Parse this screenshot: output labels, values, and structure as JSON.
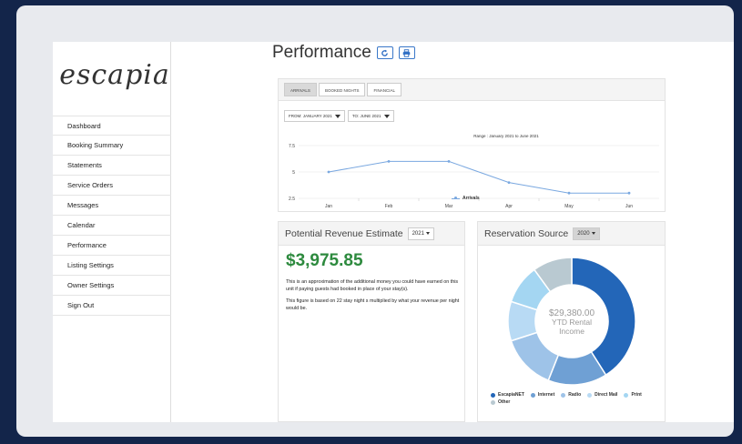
{
  "logo_text": "escapia",
  "sidebar": {
    "items": [
      {
        "label": "Dashboard"
      },
      {
        "label": "Booking Summary"
      },
      {
        "label": "Statements"
      },
      {
        "label": "Service Orders"
      },
      {
        "label": "Messages"
      },
      {
        "label": "Calendar"
      },
      {
        "label": "Performance"
      },
      {
        "label": "Listing Settings"
      },
      {
        "label": "Owner Settings"
      },
      {
        "label": "Sign Out"
      }
    ]
  },
  "header": {
    "title": "Performance",
    "refresh_icon": "refresh-icon",
    "print_icon": "print-icon"
  },
  "chart_panel": {
    "tabs": [
      {
        "label": "ARRIVALS",
        "active": true
      },
      {
        "label": "BOOKED NIGHTS",
        "active": false
      },
      {
        "label": "FINANCIAL",
        "active": false
      }
    ],
    "from_filter": "FROM: JANUARY 2021",
    "to_filter": "TO: JUNE 2021"
  },
  "chart_data": {
    "type": "line",
    "title": "Range : January 2021 to June 2021",
    "categories": [
      "Jan",
      "Feb",
      "Mar",
      "Apr",
      "May",
      "Jun"
    ],
    "series": [
      {
        "name": "Arrivals",
        "values": [
          5,
          6,
          6,
          4,
          3,
          3
        ],
        "color": "#7aa8e0"
      }
    ],
    "yticks": [
      "7.5",
      "5",
      "2.5"
    ],
    "ylim": [
      2.5,
      7.5
    ],
    "xlabel": "",
    "ylabel": "",
    "grid": true,
    "legend": "bottom"
  },
  "revenue": {
    "title": "Potential Revenue Estimate",
    "year": "2021",
    "amount": "$3,975.85",
    "text1": "This is an approximation of the additional money you could have earned on this unit if paying guests had booked in place of your stay(s).",
    "text2": "This figure is based on 22 stay night s multiplied by what your revenue per night would be."
  },
  "source": {
    "title": "Reservation Source",
    "year": "2020",
    "center_amount": "$29,380.00",
    "center_label1": "YTD Rental",
    "center_label2": "Income",
    "slices": [
      {
        "name": "EscapiaNET",
        "percent": 41,
        "color": "#2366b8"
      },
      {
        "name": "Internet",
        "percent": 15,
        "color": "#6fa0d4"
      },
      {
        "name": "Radio",
        "percent": 14,
        "color": "#9ec3e8"
      },
      {
        "name": "Direct Mail",
        "percent": 10,
        "color": "#b8daf4"
      },
      {
        "name": "Print",
        "percent": 10,
        "color": "#a4d6f2"
      },
      {
        "name": "Other",
        "percent": 10,
        "color": "#b9c9d1"
      }
    ]
  }
}
